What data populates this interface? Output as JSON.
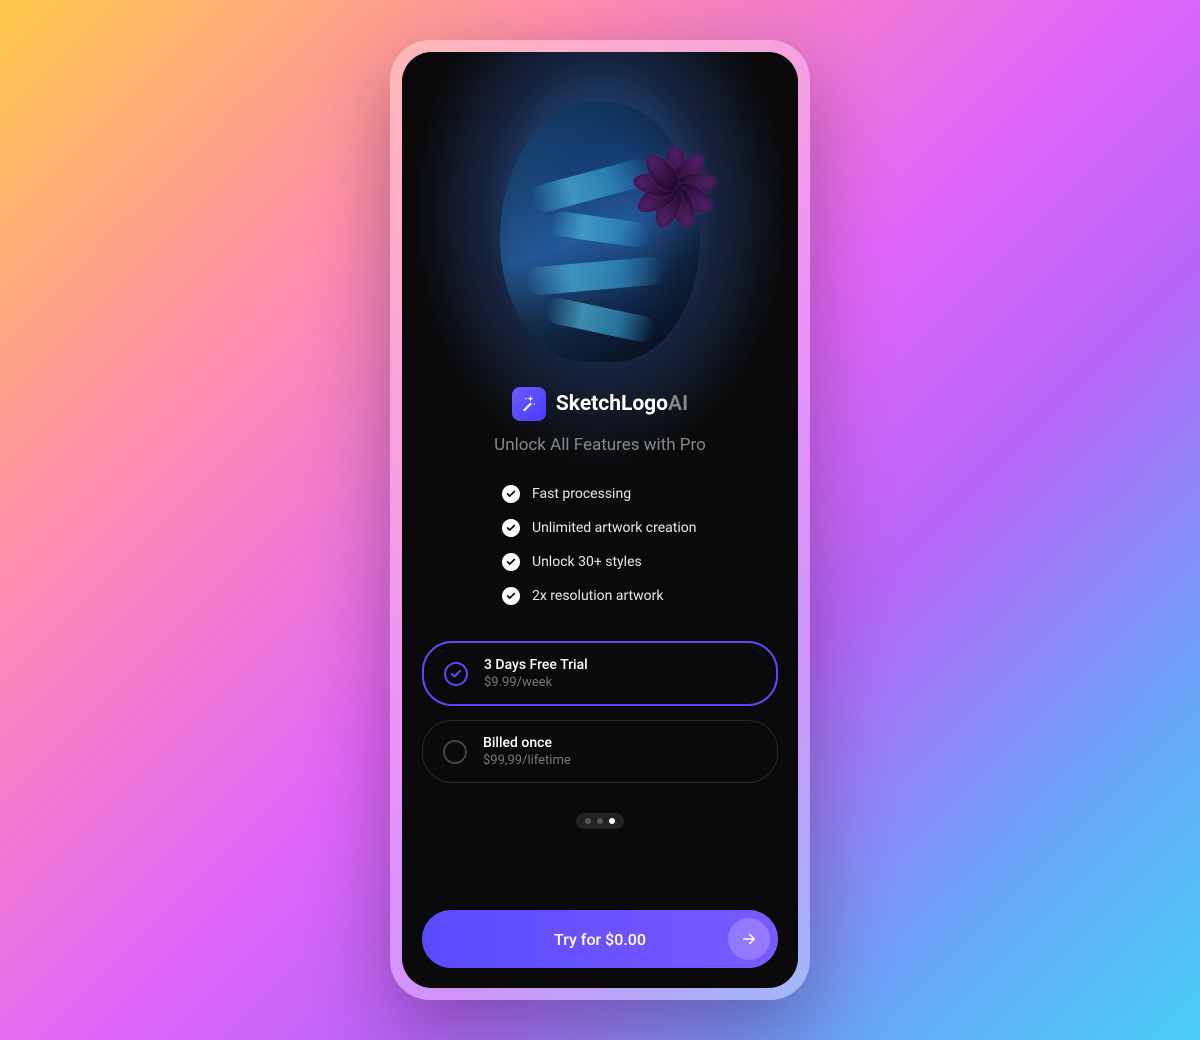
{
  "brand": {
    "name": "SketchLogo",
    "suffix": "AI",
    "icon": "wand-icon"
  },
  "subtitle": "Unlock All Features with Pro",
  "features": [
    "Fast processing",
    "Unlimited artwork creation",
    "Unlock 30+ styles",
    "2x resolution artwork"
  ],
  "plans": [
    {
      "title": "3 Days Free Trial",
      "price": "$9.99/week",
      "selected": true
    },
    {
      "title": "Billed once",
      "price": "$99,99/lifetime",
      "selected": false
    }
  ],
  "pagination": {
    "total": 3,
    "active": 2
  },
  "cta": {
    "label": "Try for $0.00"
  },
  "colors": {
    "accent": "#5a4aff",
    "accent2": "#7a5aff"
  }
}
